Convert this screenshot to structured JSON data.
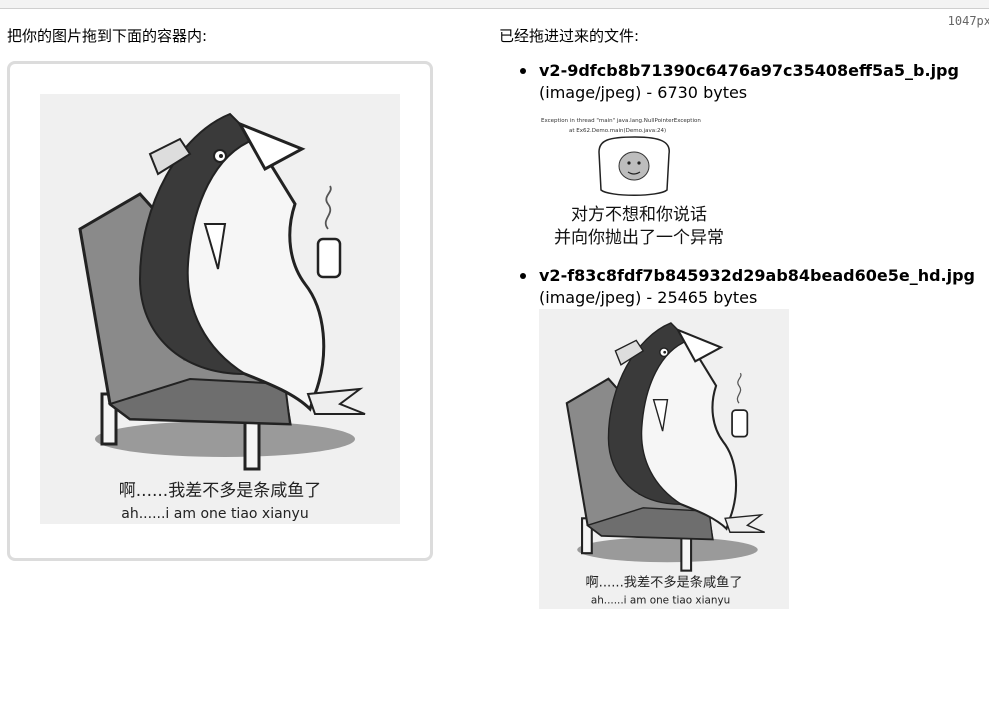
{
  "browser": {
    "width_readout": "1047px"
  },
  "left_panel": {
    "label": "把你的图片拖到下面的容器内:",
    "image": {
      "caption_cn": "啊......我差不多是条咸鱼了",
      "caption_en": "ah......i am one tiao xianyu"
    }
  },
  "right_panel": {
    "label": "已经拖进过来的文件:",
    "files": [
      {
        "name": "v2-9dfcb8b71390c6476a97c35408eff5a5_b.jpg",
        "meta": "(image/jpeg) - 6730 bytes",
        "thumb": {
          "code_line1": "Exception in thread \"main\" java.lang.NullPointerException",
          "code_line2": "at Ex62.Demo.main(Demo.java:24)",
          "line1": "对方不想和你说话",
          "line2": "并向你抛出了一个异常"
        }
      },
      {
        "name": "v2-f83c8fdf7b845932d29ab84bead60e5e_hd.jpg",
        "meta": "(image/jpeg) - 25465 bytes",
        "thumb": {
          "caption_cn": "啊......我差不多是条咸鱼了",
          "caption_en": "ah......i am one tiao xianyu"
        }
      }
    ]
  },
  "colors": {
    "dropzone_border": "#dcdcdc",
    "image_bg": "#f0f0f0",
    "chair": "#8a8a8a",
    "fish_dark": "#3a3a3a"
  }
}
